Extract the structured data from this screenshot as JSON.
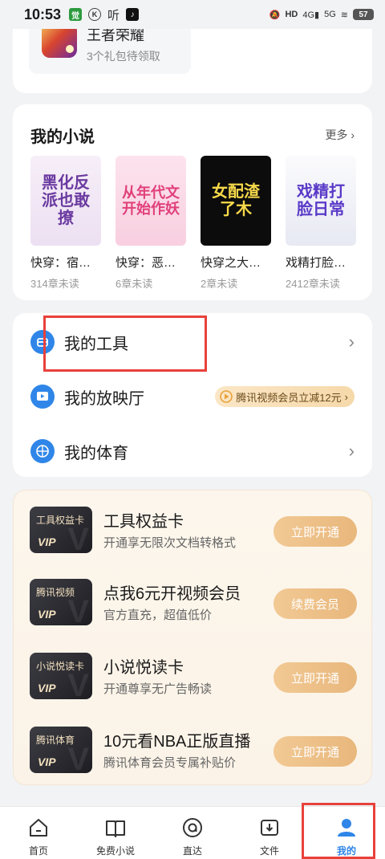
{
  "status_bar": {
    "time": "10:53",
    "battery": "57",
    "network": "5G"
  },
  "gift": {
    "title": "王者荣耀",
    "subtitle": "3个礼包待领取"
  },
  "novels": {
    "title": "我的小说",
    "more": "更多 ›",
    "books": [
      {
        "cover_text": "黑化反派也敢撩",
        "name": "快穿：宿…",
        "status": "314章未读"
      },
      {
        "cover_text": "从年代文开始作妖",
        "name": "快穿：恶…",
        "status": "6章未读"
      },
      {
        "cover_text": "女配渣了木",
        "name": "快穿之大…",
        "status": "2章未读"
      },
      {
        "cover_text": "戏精打脸日常",
        "name": "戏精打脸…",
        "status": "2412章未读"
      }
    ]
  },
  "menu": {
    "tools": "我的工具",
    "cinema": "我的放映厅",
    "cinema_promo": "腾讯视频会员立减12元",
    "sports": "我的体育"
  },
  "vip": [
    {
      "badge": "工具权益卡",
      "title": "工具权益卡",
      "desc": "开通享无限次文档转格式",
      "button": "立即开通"
    },
    {
      "badge": "腾讯视频",
      "title": "点我6元开视频会员",
      "desc": "官方直充，超值低价",
      "button": "续费会员"
    },
    {
      "badge": "小说悦读卡",
      "title": "小说悦读卡",
      "desc": "开通尊享无广告畅读",
      "button": "立即开通"
    },
    {
      "badge": "腾讯体育",
      "title": "10元看NBA正版直播",
      "desc": "腾讯体育会员专属补贴价",
      "button": "立即开通"
    }
  ],
  "vip_mark": "VIP",
  "nav": [
    {
      "label": "首页",
      "icon": "home-icon"
    },
    {
      "label": "免费小说",
      "icon": "book-icon"
    },
    {
      "label": "直达",
      "icon": "direct-icon"
    },
    {
      "label": "文件",
      "icon": "file-icon"
    },
    {
      "label": "我的",
      "icon": "profile-icon",
      "active": true
    }
  ],
  "colors": {
    "accent": "#2f86e8",
    "highlight": "#e8413c",
    "vip_button": "#e8b77c"
  }
}
